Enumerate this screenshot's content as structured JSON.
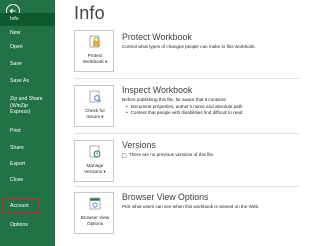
{
  "sidebar": {
    "items": [
      {
        "label": "Info",
        "active": true
      },
      {
        "label": "New"
      },
      {
        "label": "Open"
      },
      {
        "label": "Save"
      },
      {
        "label": "Save As"
      },
      {
        "label": "Zip and Share (WinZip Express)"
      },
      {
        "label": "Print"
      },
      {
        "label": "Share"
      },
      {
        "label": "Export"
      },
      {
        "label": "Close"
      },
      {
        "label": "Account",
        "highlighted": true
      },
      {
        "label": "Options"
      }
    ],
    "bg_color": "#217346",
    "highlight_color": "#d9232e"
  },
  "page": {
    "title": "Info"
  },
  "sections": {
    "protect": {
      "tile_line1": "Protect",
      "tile_line2": "Workbook ▾",
      "heading": "Protect Workbook",
      "text": "Control what types of changes people can make to this workbook.",
      "icon": "lock-icon"
    },
    "inspect": {
      "tile_line1": "Check for",
      "tile_line2": "Issues ▾",
      "heading": "Inspect Workbook",
      "text": "Before publishing this file, be aware that it contains:",
      "bullets": [
        "Document properties, author's name and absolute path",
        "Content that people with disabilities find difficult to read"
      ],
      "icon": "inspect-document-icon"
    },
    "versions": {
      "tile_line1": "Manage",
      "tile_line2": "Versions ▾",
      "heading": "Versions",
      "text": "There are no previous versions of this file.",
      "icon": "versions-icon"
    },
    "browser": {
      "tile_line1": "Browser View",
      "tile_line2": "Options",
      "heading": "Browser View Options",
      "text": "Pick what users can see when this workbook is viewed on the Web.",
      "icon": "browser-view-icon"
    }
  }
}
